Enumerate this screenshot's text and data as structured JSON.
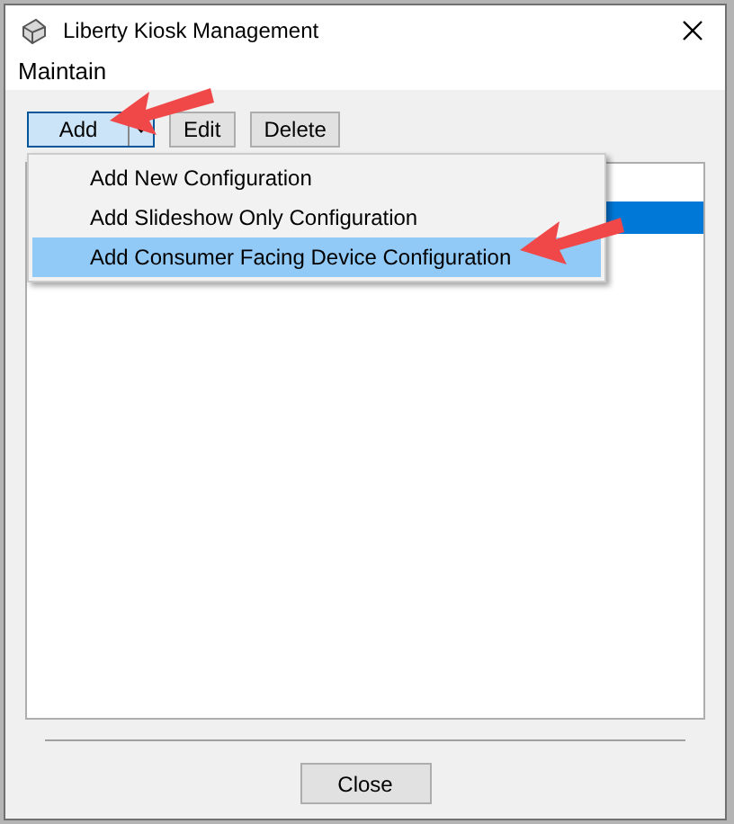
{
  "window": {
    "title": "Liberty Kiosk Management"
  },
  "menu_bar": [
    "Maintain"
  ],
  "toolbar": {
    "add_button": {
      "label": "Add",
      "pressed": true
    },
    "buttons": [
      "Edit",
      "Delete"
    ]
  },
  "dropdown": [
    {
      "label": "Add New Configuration",
      "selected": false
    },
    {
      "label": "Add Slideshow Only Configuration",
      "selected": false
    },
    {
      "label": "Add Consumer Facing Device Configuration",
      "selected": true
    }
  ],
  "list": {
    "rows": [
      {
        "selected": true
      }
    ]
  },
  "footer": {
    "button": "Close"
  }
}
